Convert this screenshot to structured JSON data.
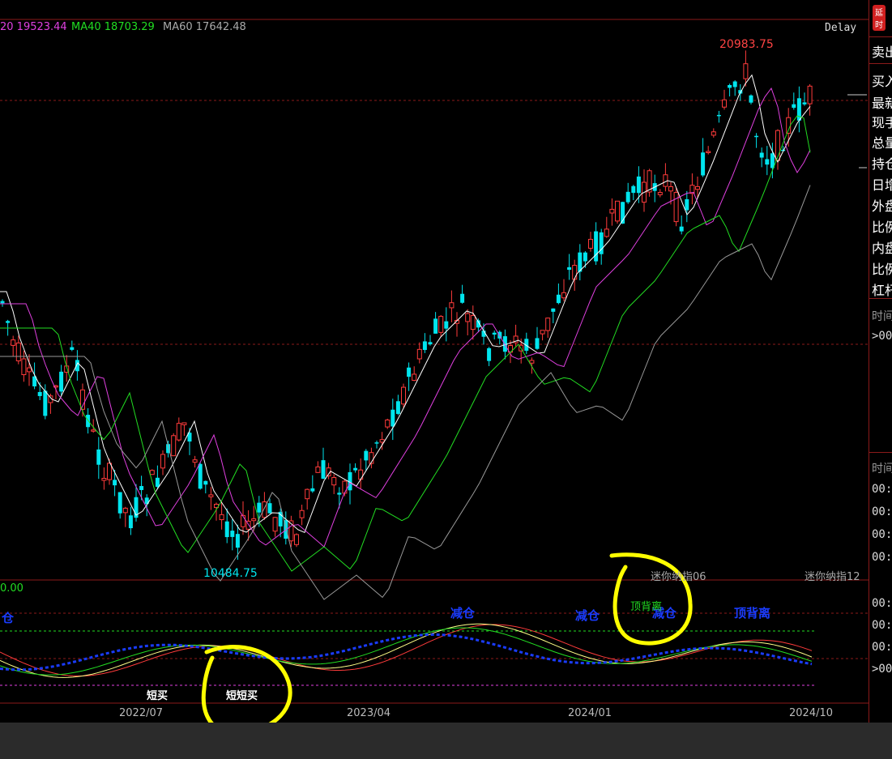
{
  "indicators": {
    "ma20": "20 19523.44",
    "ma40": "MA40 18703.29",
    "ma60": "MA60 17642.48",
    "delay": "Delay",
    "tag": "延时"
  },
  "price_labels": {
    "high": "20983.75",
    "low": "10484.75"
  },
  "contract_labels": {
    "c06": "迷你纳指06",
    "c12": "迷你纳指12"
  },
  "sub_value": "0.00",
  "x_axis": [
    "2022/07",
    "2023/04",
    "2024/01",
    "2024/10"
  ],
  "right_panel": {
    "items": [
      "卖出",
      "买入",
      "最新",
      "现手",
      "总量",
      "持仓",
      "日增",
      "外盘",
      "比例",
      "内盘",
      "比例",
      "杠杆"
    ],
    "time_headers": [
      "时间",
      "时间"
    ],
    "times": [
      ">00:",
      "00:",
      "00:",
      "00:",
      "00:",
      "00:",
      "00:",
      "00:",
      ">00:"
    ]
  },
  "signals": {
    "cang_left": "仓",
    "short_buy_1": "短买",
    "short_buy_2": "短短买",
    "jiancang_1": "减仓",
    "jiancang_2": "减仓",
    "jiancang_3": "减仓",
    "top_div_1": "顶背离",
    "top_div_2": "顶背离"
  },
  "colors": {
    "up": "#ff3b3b",
    "down": "#00e5ee",
    "ma_white": "#ffffff",
    "ma_magenta": "#e040e0",
    "ma_green": "#22dd22",
    "ma_gray": "#999999",
    "signal_blue": "#1a3cff",
    "annotation_yellow": "#ffff00"
  }
}
